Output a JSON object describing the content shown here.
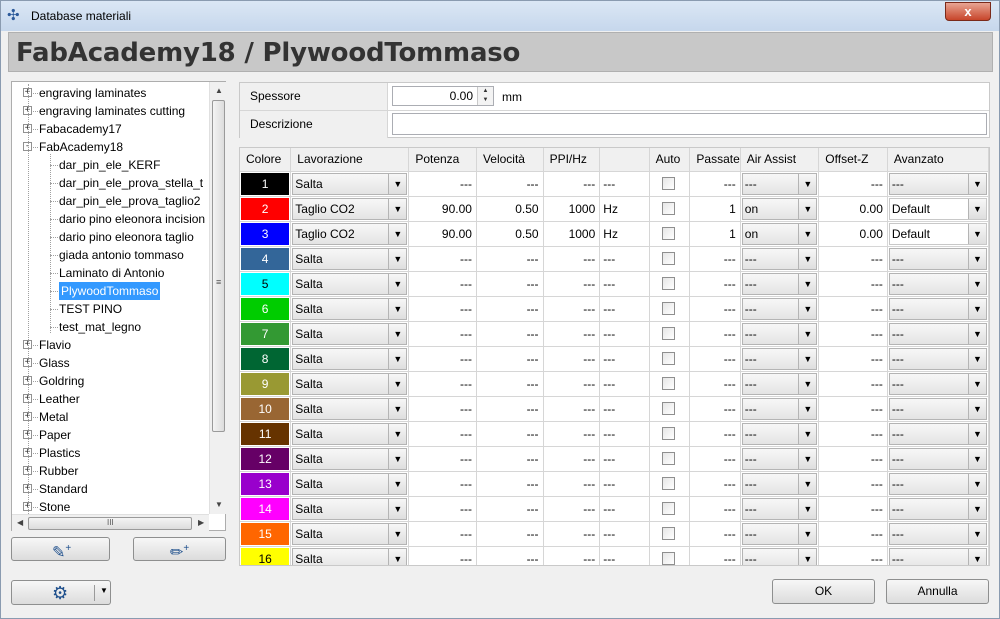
{
  "window": {
    "title": "Database materiali",
    "close_label": "x"
  },
  "header": {
    "title": "FabAcademy18 / PlywoodTommaso"
  },
  "tree": {
    "items": [
      {
        "label": "engraving laminates",
        "level": 0,
        "expander": "+"
      },
      {
        "label": "engraving laminates cutting",
        "level": 0,
        "expander": "+"
      },
      {
        "label": "Fabacademy17",
        "level": 0,
        "expander": "+"
      },
      {
        "label": "FabAcademy18",
        "level": 0,
        "expander": "-"
      },
      {
        "label": "dar_pin_ele_KERF",
        "level": 1
      },
      {
        "label": "dar_pin_ele_prova_stella_t",
        "level": 1
      },
      {
        "label": "dar_pin_ele_prova_taglio2",
        "level": 1
      },
      {
        "label": "dario pino eleonora incision",
        "level": 1
      },
      {
        "label": "dario pino eleonora taglio",
        "level": 1
      },
      {
        "label": "giada antonio tommaso",
        "level": 1
      },
      {
        "label": "Laminato di Antonio",
        "level": 1
      },
      {
        "label": "PlywoodTommaso",
        "level": 1,
        "selected": true
      },
      {
        "label": "TEST PINO",
        "level": 1
      },
      {
        "label": "test_mat_legno",
        "level": 1
      },
      {
        "label": "Flavio",
        "level": 0,
        "expander": "+"
      },
      {
        "label": "Glass",
        "level": 0,
        "expander": "+"
      },
      {
        "label": "Goldring",
        "level": 0,
        "expander": "+"
      },
      {
        "label": "Leather",
        "level": 0,
        "expander": "+"
      },
      {
        "label": "Metal",
        "level": 0,
        "expander": "+"
      },
      {
        "label": "Paper",
        "level": 0,
        "expander": "+"
      },
      {
        "label": "Plastics",
        "level": 0,
        "expander": "+"
      },
      {
        "label": "Rubber",
        "level": 0,
        "expander": "+"
      },
      {
        "label": "Standard",
        "level": 0,
        "expander": "+"
      },
      {
        "label": "Stone",
        "level": 0,
        "expander": "+"
      }
    ],
    "scroll_grip": "≡",
    "hscroll_grip": "III"
  },
  "properties": {
    "spessore_label": "Spessore",
    "spessore_value": "0.00",
    "spessore_unit": "mm",
    "descrizione_label": "Descrizione",
    "descrizione_value": ""
  },
  "grid": {
    "columns": [
      "Colore",
      "Lavorazione",
      "Potenza",
      "Velocità",
      "PPI/Hz",
      "",
      "Auto",
      "Passate",
      "Air Assist",
      "Offset-Z",
      "Avanzato"
    ],
    "rows": [
      {
        "num": "1",
        "color": "#000000",
        "text_color": "#ffffff",
        "lavorazione": "Salta",
        "potenza": "---",
        "velocita": "---",
        "ppi": "---",
        "unit": "---",
        "passate": "---",
        "air": "---",
        "offset": "---",
        "avanzato": "---"
      },
      {
        "num": "2",
        "color": "#ff0000",
        "text_color": "#ffffff",
        "lavorazione": "Taglio CO2",
        "potenza": "90.00",
        "velocita": "0.50",
        "ppi": "1000",
        "unit": "Hz",
        "passate": "1",
        "air": "on",
        "offset": "0.00",
        "avanzato": "Default"
      },
      {
        "num": "3",
        "color": "#0000ff",
        "text_color": "#ffffff",
        "lavorazione": "Taglio CO2",
        "potenza": "90.00",
        "velocita": "0.50",
        "ppi": "1000",
        "unit": "Hz",
        "passate": "1",
        "air": "on",
        "offset": "0.00",
        "avanzato": "Default"
      },
      {
        "num": "4",
        "color": "#336699",
        "text_color": "#ffffff",
        "lavorazione": "Salta",
        "potenza": "---",
        "velocita": "---",
        "ppi": "---",
        "unit": "---",
        "passate": "---",
        "air": "---",
        "offset": "---",
        "avanzato": "---"
      },
      {
        "num": "5",
        "color": "#00ffff",
        "text_color": "#000000",
        "lavorazione": "Salta",
        "potenza": "---",
        "velocita": "---",
        "ppi": "---",
        "unit": "---",
        "passate": "---",
        "air": "---",
        "offset": "---",
        "avanzato": "---"
      },
      {
        "num": "6",
        "color": "#00cc00",
        "text_color": "#ffffff",
        "lavorazione": "Salta",
        "potenza": "---",
        "velocita": "---",
        "ppi": "---",
        "unit": "---",
        "passate": "---",
        "air": "---",
        "offset": "---",
        "avanzato": "---"
      },
      {
        "num": "7",
        "color": "#339933",
        "text_color": "#ffffff",
        "lavorazione": "Salta",
        "potenza": "---",
        "velocita": "---",
        "ppi": "---",
        "unit": "---",
        "passate": "---",
        "air": "---",
        "offset": "---",
        "avanzato": "---"
      },
      {
        "num": "8",
        "color": "#006633",
        "text_color": "#ffffff",
        "lavorazione": "Salta",
        "potenza": "---",
        "velocita": "---",
        "ppi": "---",
        "unit": "---",
        "passate": "---",
        "air": "---",
        "offset": "---",
        "avanzato": "---"
      },
      {
        "num": "9",
        "color": "#999933",
        "text_color": "#ffffff",
        "lavorazione": "Salta",
        "potenza": "---",
        "velocita": "---",
        "ppi": "---",
        "unit": "---",
        "passate": "---",
        "air": "---",
        "offset": "---",
        "avanzato": "---"
      },
      {
        "num": "10",
        "color": "#996633",
        "text_color": "#ffffff",
        "lavorazione": "Salta",
        "potenza": "---",
        "velocita": "---",
        "ppi": "---",
        "unit": "---",
        "passate": "---",
        "air": "---",
        "offset": "---",
        "avanzato": "---"
      },
      {
        "num": "11",
        "color": "#663300",
        "text_color": "#ffffff",
        "lavorazione": "Salta",
        "potenza": "---",
        "velocita": "---",
        "ppi": "---",
        "unit": "---",
        "passate": "---",
        "air": "---",
        "offset": "---",
        "avanzato": "---"
      },
      {
        "num": "12",
        "color": "#660066",
        "text_color": "#ffffff",
        "lavorazione": "Salta",
        "potenza": "---",
        "velocita": "---",
        "ppi": "---",
        "unit": "---",
        "passate": "---",
        "air": "---",
        "offset": "---",
        "avanzato": "---"
      },
      {
        "num": "13",
        "color": "#9900cc",
        "text_color": "#ffffff",
        "lavorazione": "Salta",
        "potenza": "---",
        "velocita": "---",
        "ppi": "---",
        "unit": "---",
        "passate": "---",
        "air": "---",
        "offset": "---",
        "avanzato": "---"
      },
      {
        "num": "14",
        "color": "#ff00ff",
        "text_color": "#ffffff",
        "lavorazione": "Salta",
        "potenza": "---",
        "velocita": "---",
        "ppi": "---",
        "unit": "---",
        "passate": "---",
        "air": "---",
        "offset": "---",
        "avanzato": "---"
      },
      {
        "num": "15",
        "color": "#ff6600",
        "text_color": "#ffffff",
        "lavorazione": "Salta",
        "potenza": "---",
        "velocita": "---",
        "ppi": "---",
        "unit": "---",
        "passate": "---",
        "air": "---",
        "offset": "---",
        "avanzato": "---"
      },
      {
        "num": "16",
        "color": "#ffff00",
        "text_color": "#000000",
        "lavorazione": "Salta",
        "potenza": "---",
        "velocita": "---",
        "ppi": "---",
        "unit": "---",
        "passate": "---",
        "air": "---",
        "offset": "---",
        "avanzato": "---"
      }
    ]
  },
  "buttons": {
    "ok": "OK",
    "cancel": "Annulla"
  },
  "icons": {
    "app": "laser-icon",
    "new_material": "add-material-icon",
    "new_folder": "add-item-icon",
    "settings": "gear-icon"
  }
}
